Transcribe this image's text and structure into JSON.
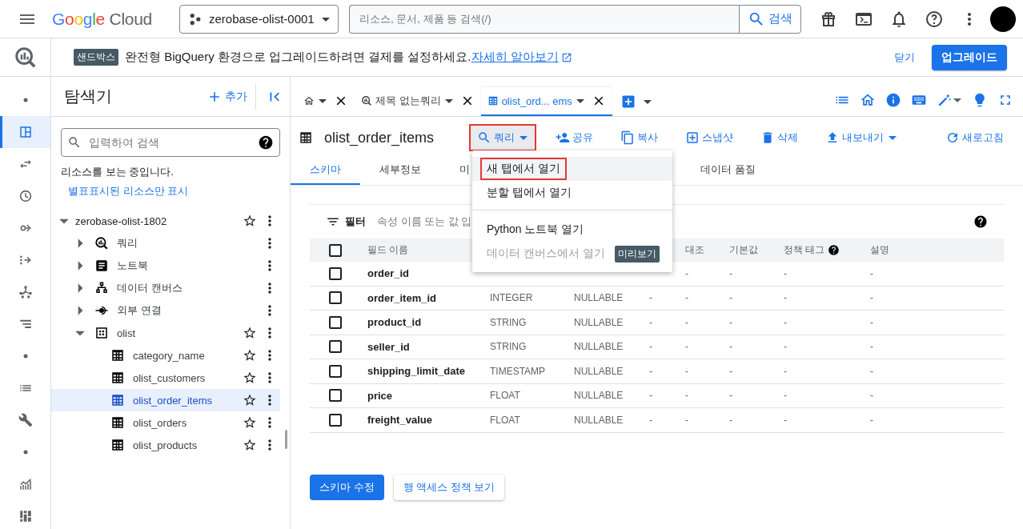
{
  "top_bar": {
    "logo": "Google Cloud",
    "project": "zerobase-olist-0001",
    "search": {
      "placeholder": "리소스, 문서, 제품 등 검색(/)"
    },
    "search_button": "검색"
  },
  "banner": {
    "badge": "샌드박스",
    "message": "완전형 BigQuery 환경으로 업그레이드하려면 결제를 설정하세요.",
    "link": "자세히 알아보기",
    "dismiss": "닫기",
    "upgrade": "업그레이드"
  },
  "rail": [
    {
      "kind": "dot",
      "selected": false
    },
    {
      "kind": "panel",
      "selected": true
    },
    {
      "kind": "transfer",
      "selected": false
    },
    {
      "kind": "clock",
      "selected": false
    },
    {
      "kind": "pipeline",
      "selected": false
    },
    {
      "kind": "flow",
      "selected": false
    },
    {
      "kind": "graph",
      "selected": false
    },
    {
      "kind": "tree",
      "selected": false
    },
    {
      "kind": "dot",
      "selected": false
    },
    {
      "kind": "list",
      "selected": false
    },
    {
      "kind": "wrench",
      "selected": false
    },
    {
      "kind": "dot",
      "selected": false
    },
    {
      "kind": "chart",
      "selected": false
    },
    {
      "kind": "dashboard",
      "selected": false
    }
  ],
  "explorer": {
    "title": "탐색기",
    "add": "추가",
    "search": {
      "placeholder": "입력하여 검색"
    },
    "status": "리소스를 보는 중입니다.",
    "starred_link": "별표표시된 리소스만 표시",
    "tree": [
      {
        "label": "zerobase-olist-1802",
        "kind": "project",
        "expanded": true,
        "starred": false,
        "selected": false,
        "children": [
          {
            "label": "쿼리",
            "kind": "queries",
            "expanded": false,
            "selected": false
          },
          {
            "label": "노트북",
            "kind": "notebooks",
            "expanded": false,
            "selected": false
          },
          {
            "label": "데이터 캔버스",
            "kind": "canvases",
            "expanded": false,
            "selected": false
          },
          {
            "label": "외부 연결",
            "kind": "connections",
            "expanded": false,
            "selected": false
          },
          {
            "label": "olist",
            "kind": "dataset",
            "expanded": true,
            "starred": false,
            "selected": false,
            "children": [
              {
                "label": "category_name",
                "kind": "table",
                "starred": false,
                "selected": false
              },
              {
                "label": "olist_customers",
                "kind": "table",
                "starred": false,
                "selected": false
              },
              {
                "label": "olist_order_items",
                "kind": "table",
                "starred": false,
                "selected": true
              },
              {
                "label": "olist_orders",
                "kind": "table",
                "starred": false,
                "selected": false
              },
              {
                "label": "olist_products",
                "kind": "table",
                "starred": false,
                "selected": false
              }
            ]
          }
        ]
      }
    ]
  },
  "tabs": [
    {
      "kind": "home",
      "selected": false
    },
    {
      "kind": "query",
      "label": "제목 없는쿼리",
      "selected": false
    },
    {
      "kind": "table",
      "label": "olist_ord... ems",
      "selected": true
    }
  ],
  "table_title": "olist_order_items",
  "actions": [
    {
      "kind": "query",
      "label": "쿼리",
      "dropdown": true,
      "active": true,
      "highlighted": true
    },
    {
      "kind": "share",
      "label": "공유",
      "dropdown": false,
      "active": false,
      "highlighted": false
    },
    {
      "kind": "copy",
      "label": "복사",
      "dropdown": false,
      "active": false,
      "highlighted": false
    },
    {
      "kind": "snapshot",
      "label": "스냅샷",
      "dropdown": false,
      "active": false,
      "highlighted": false
    },
    {
      "kind": "delete",
      "label": "삭제",
      "dropdown": false,
      "active": false,
      "highlighted": false
    },
    {
      "kind": "export",
      "label": "내보내기",
      "dropdown": true,
      "active": false,
      "highlighted": false
    },
    {
      "kind": "refresh",
      "label": "새로고침",
      "dropdown": false,
      "active": false,
      "highlighted": false
    }
  ],
  "subtabs": [
    {
      "label": "스키마",
      "selected": true
    },
    {
      "label": "세부정보",
      "selected": false
    },
    {
      "label": "미",
      "selected": false
    },
    {
      "label": "데이터 품질",
      "selected": false
    }
  ],
  "menu": {
    "sections": [
      [
        {
          "label": "새 탭에서 열기",
          "hovered": true,
          "highlighted": true,
          "disabled": false
        },
        {
          "label": "분할 탭에서 열기",
          "hovered": false,
          "highlighted": false,
          "disabled": false
        }
      ],
      [
        {
          "label": "Python 노트북 열기",
          "hovered": false,
          "highlighted": false,
          "disabled": false
        },
        {
          "label": "데이터 캔버스에서 열기",
          "hovered": false,
          "highlighted": false,
          "disabled": true,
          "badge": "미리보기"
        }
      ]
    ]
  },
  "schema": {
    "filter_label": "필터",
    "filter_placeholder": "속성 이름 또는 값 입",
    "select_all": false,
    "columns": [
      {
        "label": "필드 이름",
        "help": false
      },
      null,
      null,
      null,
      {
        "label": "대조",
        "help": false
      },
      {
        "label": "기본값",
        "help": false
      },
      {
        "label": "정책 태그",
        "help": true
      },
      {
        "label": "설명",
        "help": false
      }
    ],
    "rows": [
      {
        "checked": false,
        "cells": [
          "order_id",
          null,
          null,
          null,
          "-",
          "-",
          "-",
          "-"
        ]
      },
      {
        "checked": false,
        "cells": [
          "order_item_id",
          "INTEGER",
          "NULLABLE",
          "-",
          "-",
          "-",
          "-",
          "-"
        ]
      },
      {
        "checked": false,
        "cells": [
          "product_id",
          "STRING",
          "NULLABLE",
          "-",
          "-",
          "-",
          "-",
          "-"
        ]
      },
      {
        "checked": false,
        "cells": [
          "seller_id",
          "STRING",
          "NULLABLE",
          "-",
          "-",
          "-",
          "-",
          "-"
        ]
      },
      {
        "checked": false,
        "cells": [
          "shipping_limit_date",
          "TIMESTAMP",
          "NULLABLE",
          "-",
          "-",
          "-",
          "-",
          "-"
        ]
      },
      {
        "checked": false,
        "cells": [
          "price",
          "FLOAT",
          "NULLABLE",
          "-",
          "-",
          "-",
          "-",
          "-"
        ]
      },
      {
        "checked": false,
        "cells": [
          "freight_value",
          "FLOAT",
          "NULLABLE",
          "-",
          "-",
          "-",
          "-",
          "-"
        ]
      }
    ]
  },
  "buttons": [
    {
      "kind": "primary",
      "label": "스키마 수정"
    },
    {
      "kind": "secondary",
      "label": "행 액세스 정책 보기"
    }
  ]
}
